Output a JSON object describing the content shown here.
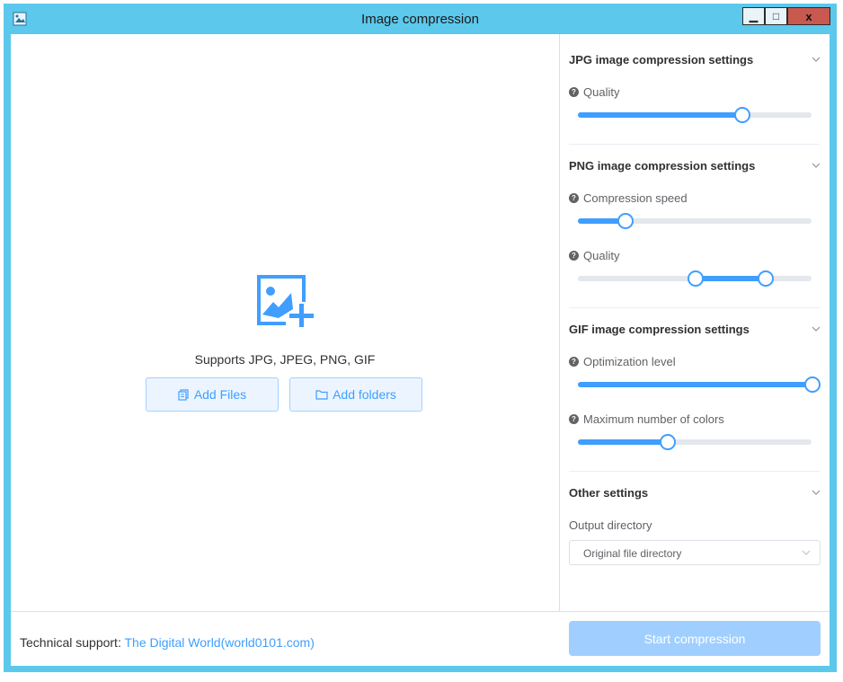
{
  "window": {
    "title": "Image compression"
  },
  "window_controls": {
    "minimize": "▁",
    "maximize": "□",
    "close": "x"
  },
  "dropzone": {
    "supports_text": "Supports JPG, JPEG, PNG, GIF",
    "add_files_label": "Add Files",
    "add_folders_label": "Add folders"
  },
  "settings": {
    "jpg": {
      "title": "JPG image compression settings",
      "quality_label": "Quality",
      "quality_value": 0.7
    },
    "png": {
      "title": "PNG image compression settings",
      "speed_label": "Compression speed",
      "speed_value": 0.2,
      "quality_label": "Quality",
      "quality_range": [
        0.5,
        0.8
      ]
    },
    "gif": {
      "title": "GIF image compression settings",
      "optimization_label": "Optimization level",
      "optimization_value": 1.0,
      "colors_label": "Maximum number of colors",
      "colors_value": 0.38
    },
    "other": {
      "title": "Other settings",
      "output_label": "Output directory",
      "output_value": "Original file directory"
    }
  },
  "footer": {
    "support_label": "Technical support:",
    "support_link": "The Digital World(world0101.com)",
    "start_label": "Start compression"
  },
  "colors": {
    "accent": "#409eff",
    "titlebar": "#5bc8ec",
    "disabled_button": "#a0cfff",
    "close_button": "#c9584e"
  }
}
